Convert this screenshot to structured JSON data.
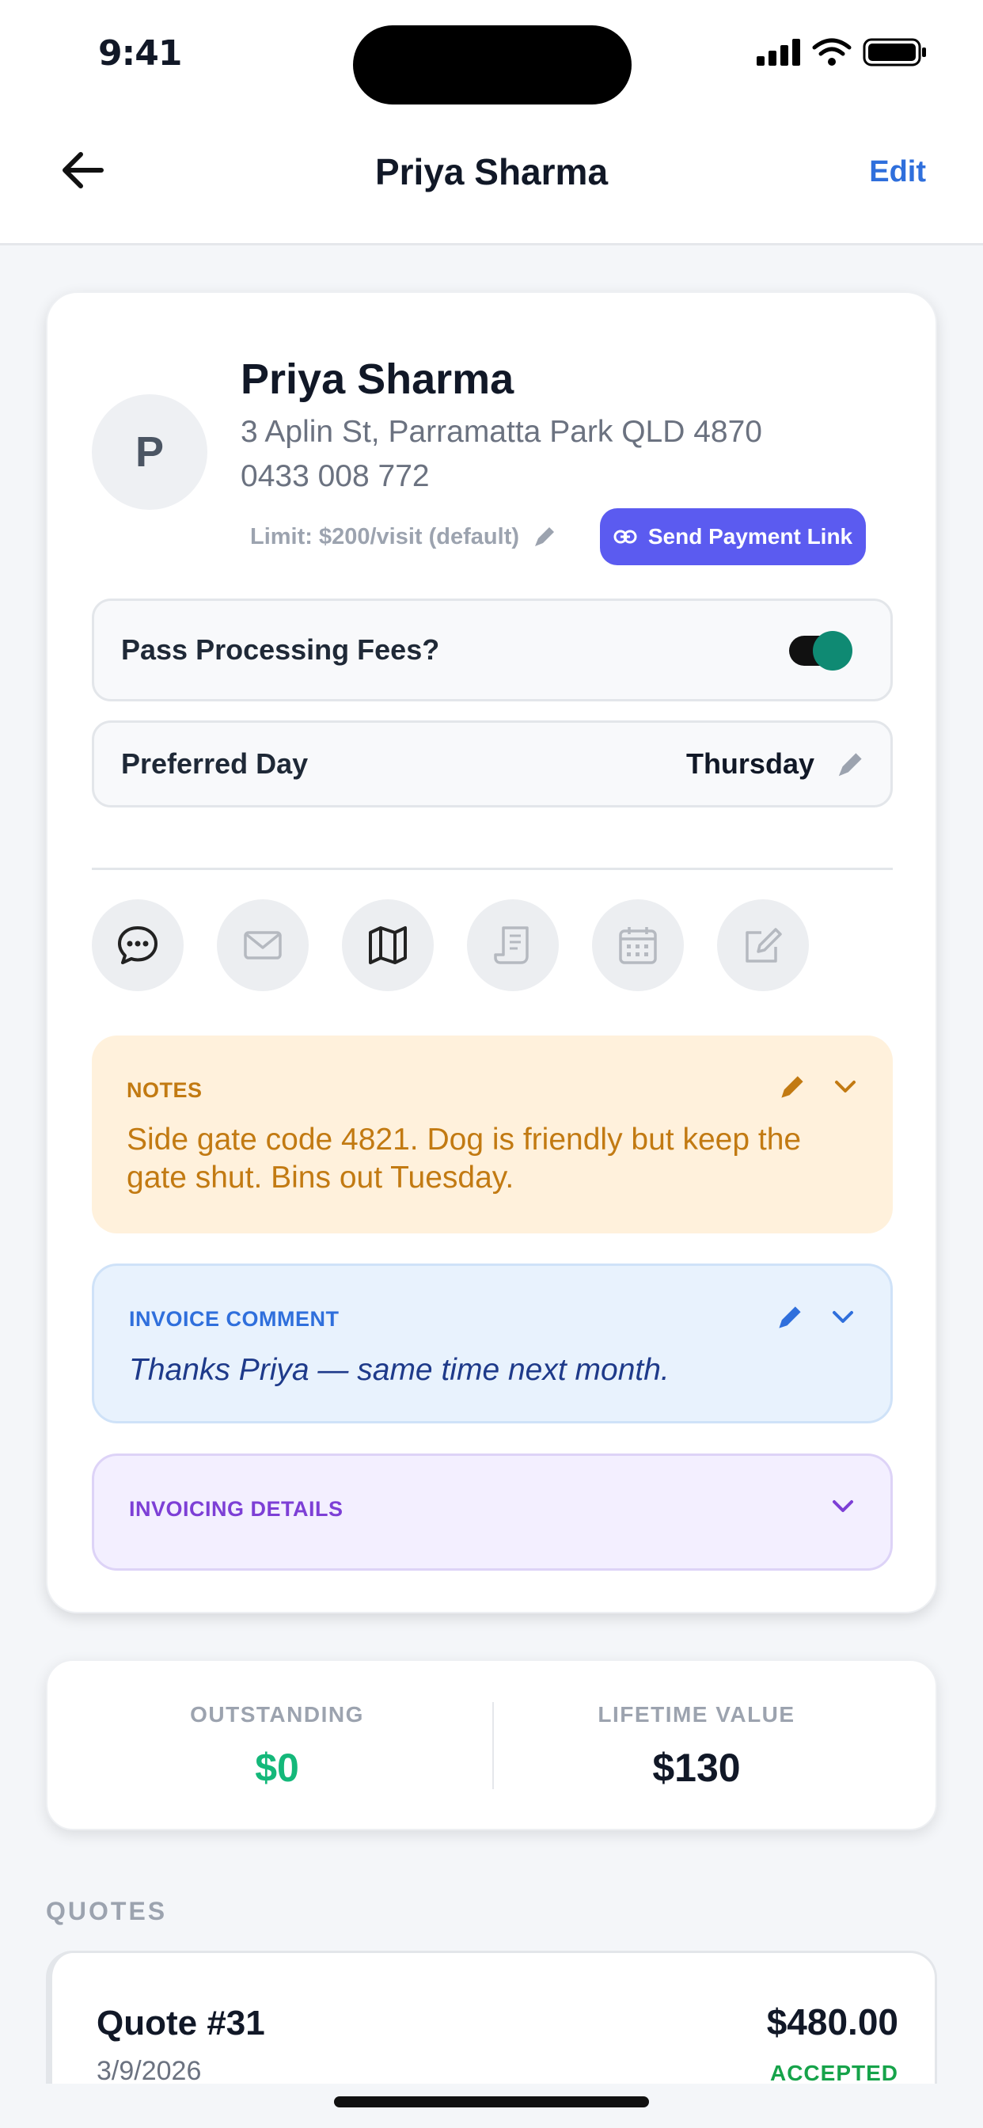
{
  "status_bar": {
    "time": "9:41"
  },
  "nav": {
    "title": "Priya Sharma",
    "edit_label": "Edit"
  },
  "client": {
    "avatar_initial": "P",
    "name": "Priya Sharma",
    "address": "3 Aplin St, Parramatta Park QLD 4870",
    "phone": "0433 008 772",
    "limit": "Limit: $200/visit (default)",
    "send_payment_link": "Send Payment Link"
  },
  "settings": {
    "fees_label": "Pass Processing Fees?",
    "fees_enabled": true,
    "preferred_day_label": "Preferred Day",
    "preferred_day_value": "Thursday"
  },
  "actions": [
    "message-icon",
    "mail-icon",
    "map-icon",
    "receipt-icon",
    "calendar-icon",
    "note-edit-icon"
  ],
  "notes": {
    "title": "NOTES",
    "text": "Side gate code 4821. Dog is friendly but keep the gate shut. Bins out Tuesday."
  },
  "invoice_comment": {
    "title": "INVOICE COMMENT",
    "text": "Thanks Priya — same time next month."
  },
  "invoicing_details": {
    "title": "INVOICING DETAILS"
  },
  "stats": {
    "outstanding_label": "OUTSTANDING",
    "outstanding_value": "$0",
    "lifetime_label": "LIFETIME VALUE",
    "lifetime_value": "$130"
  },
  "quotes": {
    "section_label": "QUOTES",
    "items": [
      {
        "title": "Quote #31",
        "date": "3/9/2026",
        "amount": "$480.00",
        "status": "ACCEPTED"
      }
    ]
  },
  "colors": {
    "accent": "#2f6fdc",
    "payment_button": "#5b5bf0",
    "toggle_on": "#0f8a73",
    "notes_text": "#c27a12",
    "outstanding": "#14b87a",
    "accepted": "#16a34a"
  }
}
